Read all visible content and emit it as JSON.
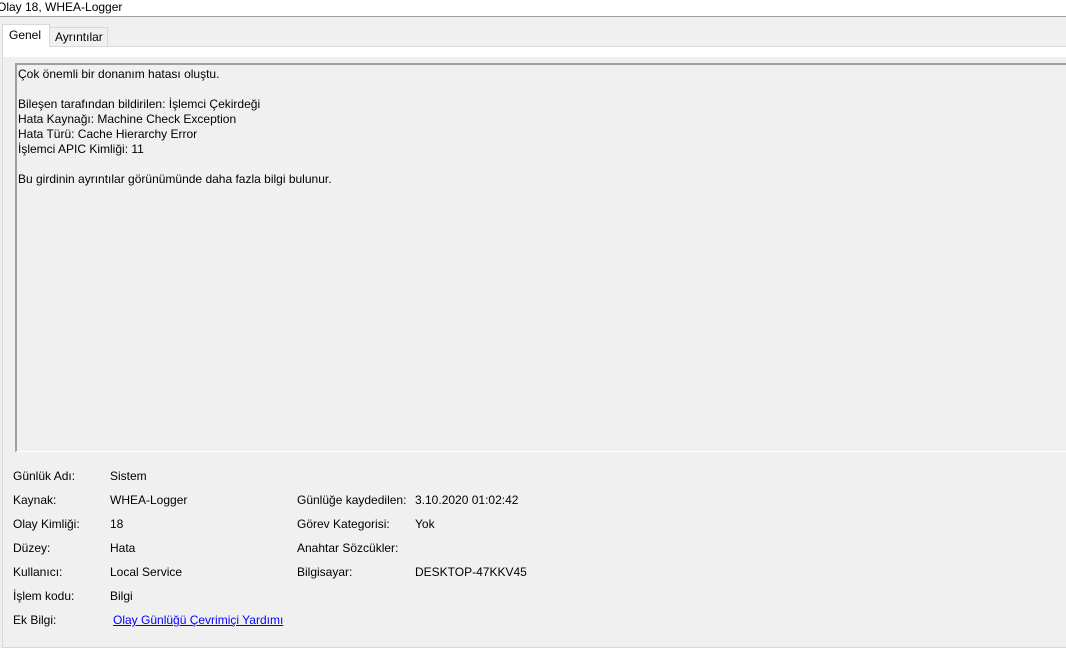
{
  "window": {
    "title": "Olay 18, WHEA-Logger"
  },
  "tabs": [
    {
      "label": "Genel",
      "selected": true
    },
    {
      "label": "Ayrıntılar",
      "selected": false
    }
  ],
  "description": {
    "text": "Çok önemli bir donanım hatası oluştu.\n\nBileşen tarafından bildirilen: İşlemci Çekirdeği\nHata Kaynağı: Machine Check Exception\nHata Türü: Cache Hierarchy Error\nİşlemci APIC Kimliği: 11\n\nBu girdinin ayrıntılar görünümünde daha fazla bilgi bulunur."
  },
  "properties": {
    "log_name": {
      "label": "Günlük Adı:",
      "value": "Sistem"
    },
    "source": {
      "label": "Kaynak:",
      "value": "WHEA-Logger"
    },
    "logged": {
      "label": "Günlüğe kaydedilen:",
      "value": "3.10.2020 01:02:42"
    },
    "event_id": {
      "label": "Olay Kimliği:",
      "value": "18"
    },
    "task_category": {
      "label": "Görev Kategorisi:",
      "value": "Yok"
    },
    "level": {
      "label": "Düzey:",
      "value": "Hata"
    },
    "keywords": {
      "label": "Anahtar Sözcükler:",
      "value": ""
    },
    "user": {
      "label": "Kullanıcı:",
      "value": "Local Service"
    },
    "computer": {
      "label": "Bilgisayar:",
      "value": "DESKTOP-47KKV45"
    },
    "opcode": {
      "label": "İşlem kodu:",
      "value": "Bilgi"
    },
    "more_info": {
      "label": "Ek Bilgi:",
      "link": "Olay Günlüğü Çevrimiçi Yardımı"
    }
  },
  "colors": {
    "window_bg": "#f0f0f0",
    "tab_selected_bg": "#ffffff",
    "link": "#0000ff"
  }
}
